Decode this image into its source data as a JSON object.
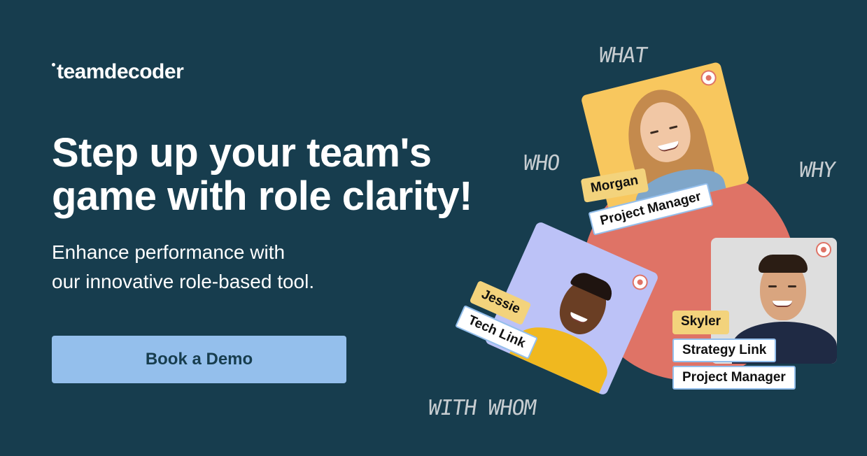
{
  "brand": {
    "logo_text": "teamdecoder"
  },
  "hero": {
    "headline_line1": "Step up your team's",
    "headline_line2": "game with role clarity!",
    "sub_line1": "Enhance performance with",
    "sub_line2": "our innovative role-based tool.",
    "cta_label": "Book a Demo"
  },
  "scribbles": {
    "what": "WHAT",
    "who": "WHO",
    "why": "WHY",
    "with_whom": "WITH WHOM"
  },
  "cards": {
    "morgan": {
      "name": "Morgan",
      "role": "Project Manager"
    },
    "jessie": {
      "name": "Jessie",
      "role": "Tech Link"
    },
    "skyler": {
      "name": "Skyler",
      "role1": "Strategy Link",
      "role2": "Project Manager"
    }
  },
  "colors": {
    "background": "#173d4e",
    "accent_button": "#94bfec",
    "blob": "#df7366",
    "name_tag": "#f3d37c",
    "card_morgan": "#f8c75e",
    "card_jessie": "#bcc2f7",
    "card_skyler": "#dedede"
  }
}
